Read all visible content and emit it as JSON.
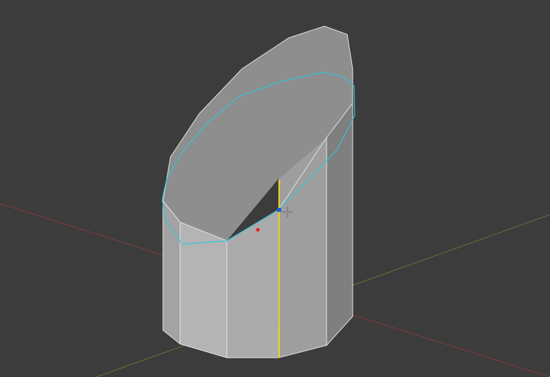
{
  "viewport": {
    "mode": "Edit Mode",
    "background_color": "#3c3c3c"
  },
  "axes": {
    "x_axis_color": "#8a3a3a",
    "y_axis_color": "#5d7a3a"
  },
  "mesh": {
    "object": "cylinder",
    "vertex_count_ring": 10,
    "face_colors": {
      "top": "#8f8f8f",
      "front": "#a9a9a9",
      "left": "#b3b3b3",
      "right": "#7e7e7e",
      "left_back": "#9b9b9b"
    },
    "wire_color": "#e8e8e8"
  },
  "tool": {
    "name": "loop-cut",
    "loop_color": "#2ec7d8",
    "selected_edge_color": "#f2d21e",
    "active_vertex_color": "#1f5ed6",
    "origin_color": "#e02020"
  },
  "icons": {
    "cursor": "move-cursor-icon"
  }
}
